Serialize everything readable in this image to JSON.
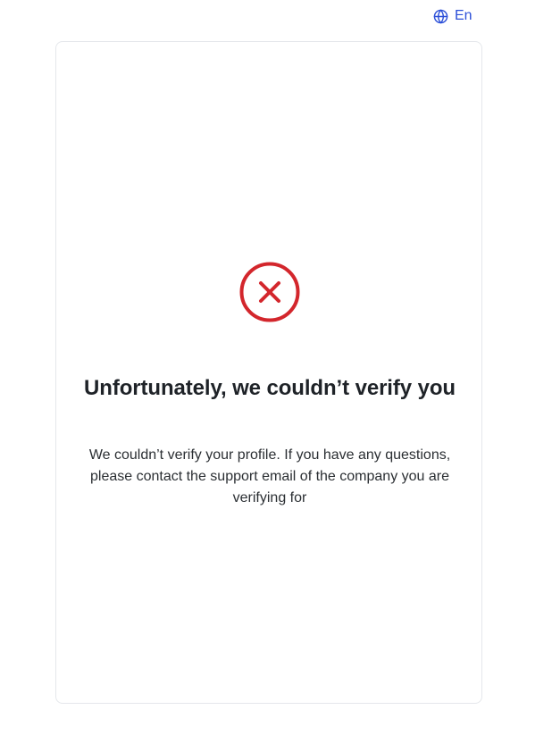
{
  "header": {
    "language_label": "En",
    "language_icon": "globe-icon"
  },
  "status": {
    "icon": "error-x-circle-icon",
    "color": "#d3262c",
    "title": "Unfortunately, we couldn’t verify you",
    "message": "We couldn’t verify your profile. If you have any questions, please contact the support email of the company you are verifying for"
  },
  "colors": {
    "accent": "#2b4fd8",
    "error": "#d3262c",
    "text": "#1f2328",
    "card_border": "#e5e7eb"
  }
}
